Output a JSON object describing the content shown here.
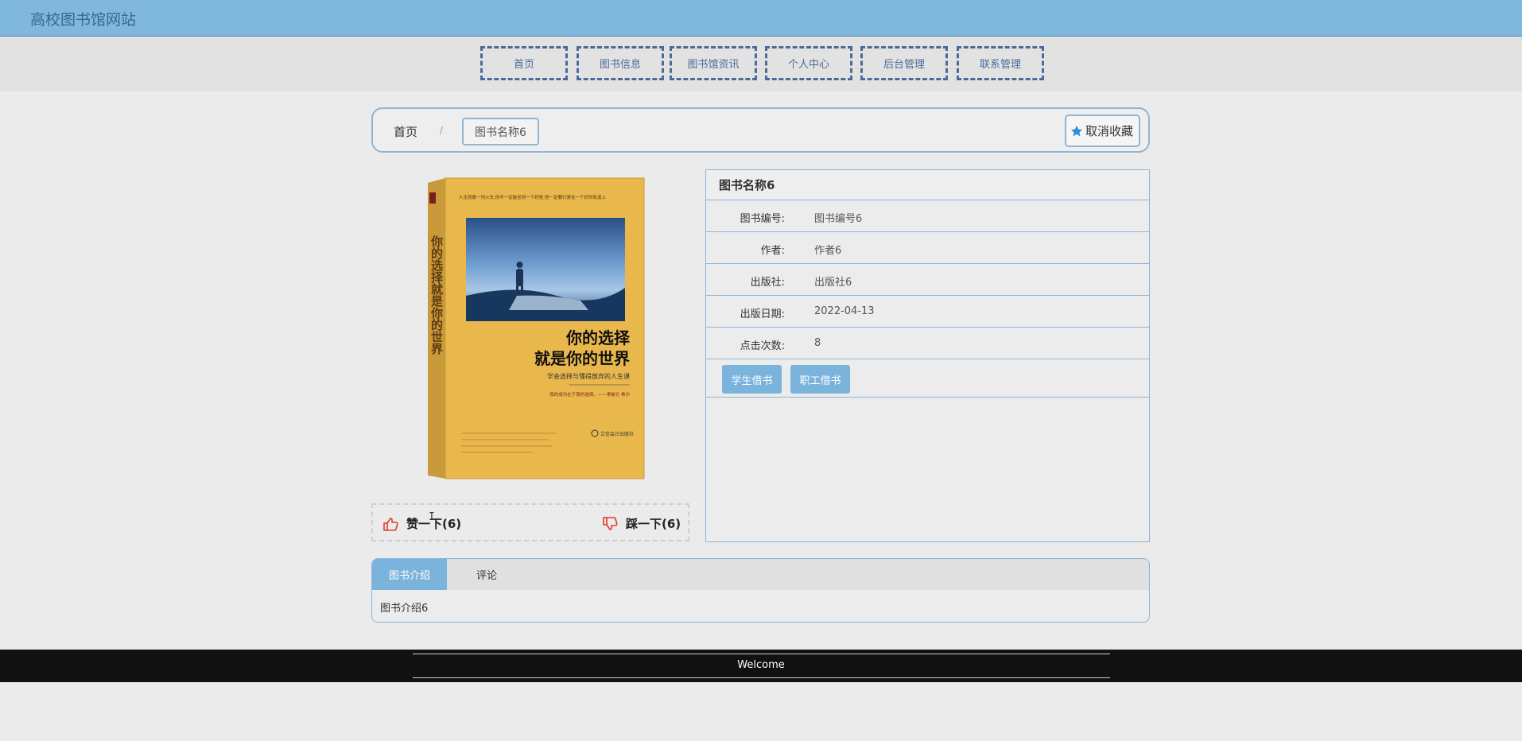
{
  "header": {
    "site_title": "高校图书馆网站"
  },
  "nav": {
    "items": [
      "首页",
      "图书信息",
      "图书馆资讯",
      "个人中心",
      "后台管理",
      "联系管理"
    ]
  },
  "breadcrumb": {
    "home": "首页",
    "separator": "/",
    "current": "图书名称6"
  },
  "favorite_button": {
    "label": "取消收藏"
  },
  "book": {
    "cover": {
      "top_text": "人生就像一列火车,你不一定能坐到一个好座,但一定要行驶在一个好的轨道上",
      "side_title": "你的选择就是你的世界",
      "title_line1": "你的选择",
      "title_line2": "就是你的世界",
      "subtitle": "学会选择与懂得放弃的人生课",
      "quote": "我的成功在于我的选择。——拿破仑·希尔",
      "publisher": "立信会计出版社"
    },
    "title": "图书名称6",
    "fields": [
      {
        "label": "图书编号:",
        "value": "图书编号6"
      },
      {
        "label": "作者:",
        "value": "作者6"
      },
      {
        "label": "出版社:",
        "value": "出版社6"
      },
      {
        "label": "出版日期:",
        "value": "2022-04-13"
      },
      {
        "label": "点击次数:",
        "value": "8"
      }
    ],
    "buttons": {
      "student": "学生借书",
      "staff": "职工借书"
    }
  },
  "vote": {
    "up": "赞一下(6)",
    "down": "踩一下(6)"
  },
  "tabs": {
    "intro_label": "图书介绍",
    "comment_label": "评论",
    "intro_text": "图书介绍6"
  },
  "footer": {
    "text": "Welcome"
  },
  "colors": {
    "accent": "#7ab3dc",
    "header_bg": "#80b7dc",
    "border": "#8fb5d5",
    "nav_border": "#4a6b9a",
    "vote_icon": "#e03a2e"
  }
}
